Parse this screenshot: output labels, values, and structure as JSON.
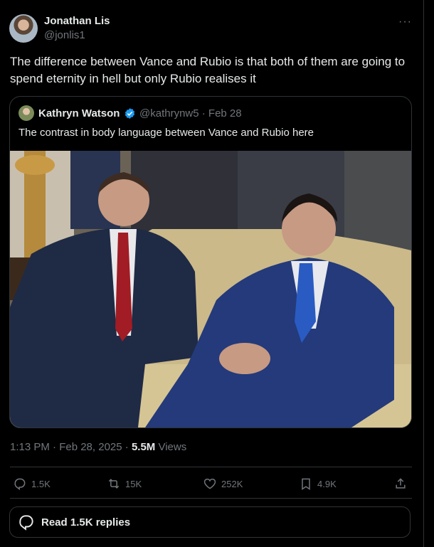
{
  "post": {
    "author_name": "Jonathan Lis",
    "author_handle": "@jonlis1",
    "more_label": "···",
    "text": "The difference between Vance and Rubio is that both of them are going to spend eternity in hell but only Rubio realises it"
  },
  "quoted": {
    "author_name": "Kathryn Watson",
    "meta": "@kathrynw5 · Feb 28",
    "text": "The contrast in body language between Vance and Rubio here"
  },
  "timestamp": {
    "time_date": "1:13 PM · Feb 28, 2025 · ",
    "views_count": "5.5M",
    "views_label": " Views"
  },
  "actions": {
    "replies": "1.5K",
    "reposts": "15K",
    "likes": "252K",
    "bookmarks": "4.9K"
  },
  "read_replies_label": "Read 1.5K replies",
  "colors": {
    "background": "#000000",
    "text": "#e7e9ea",
    "muted": "#71767b",
    "border": "#2f3336",
    "verified": "#1d9bf0"
  }
}
